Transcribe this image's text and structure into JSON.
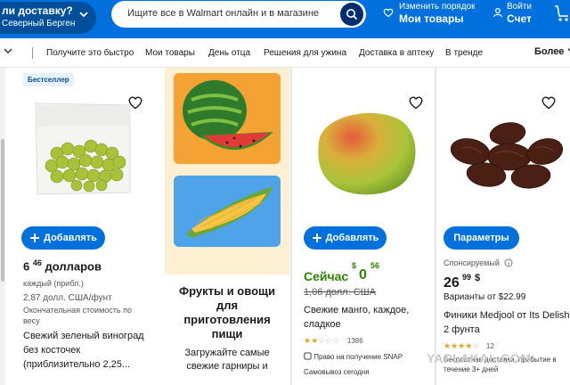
{
  "header": {
    "delivery_line1": "ли доставку?",
    "delivery_line2": "Северный Берген",
    "search_placeholder": "Ищите все в Walmart онлайн и в магазине",
    "orders_line1": "Изменить порядок",
    "orders_line2": "Мои товары",
    "account_line1": "Войти",
    "account_line2": "Счет",
    "brand_color": "#0071dc"
  },
  "nav": {
    "items": [
      "Получите это быстро",
      "Мои товары",
      "День отца",
      "Решения для ужина",
      "Доставка в аптеку",
      "В тренде"
    ],
    "more": "Более"
  },
  "products": {
    "grapes": {
      "badge": "Бестселлер",
      "add_label": "Добавлять",
      "price_whole": "6",
      "price_cents": "46",
      "price_unit": "долларов",
      "each": "каждый (прибл.)",
      "per_lb": "2,87 долл. США/фунт",
      "final_line1": "Окончательная стоимость по",
      "final_line2": "весу",
      "title_line1": "Свежий зеленый виноград",
      "title_line2": "без косточек",
      "title_line3": "(приблизительно 2,25..."
    },
    "promo": {
      "title_line1": "Фрукты и овощи",
      "title_line2": "для",
      "title_line3": "приготовления",
      "title_line4": "пищи",
      "sub_line1": "Загружайте самые",
      "sub_line2": "свежие гарниры и"
    },
    "mango": {
      "add_label": "Добавлять",
      "now_label": "Сейчас",
      "price_dollar": "$",
      "price_whole": "0",
      "price_cents": "56",
      "old_price": "1,06 долл. США",
      "title_line1": "Свежие манго, каждое,",
      "title_line2": "сладкое",
      "rating": 2,
      "rating_count": "1386",
      "snap": "Право на получение SNAP",
      "pickup": "Самовывоз сегодня"
    },
    "dates": {
      "options_label": "Параметры",
      "sponsored": "Спонсируемый",
      "price_whole": "26",
      "price_cents": "99",
      "price_dollar": "$",
      "variants": "Варианты от $22.99",
      "title_line1": "Финики Medjool от Its Delish,",
      "title_line2": "2 фунта",
      "rating": 4,
      "rating_count": "12",
      "shipping_line1": "Бесплатная доставка, прибытие в",
      "shipping_line2": "течение 3+ дней"
    }
  },
  "watermark": "YAPLAKAL.COM",
  "icons": {
    "search": "search-icon",
    "heart": "heart-icon",
    "person": "person-icon",
    "cart": "cart-icon",
    "plus": "plus-icon"
  }
}
